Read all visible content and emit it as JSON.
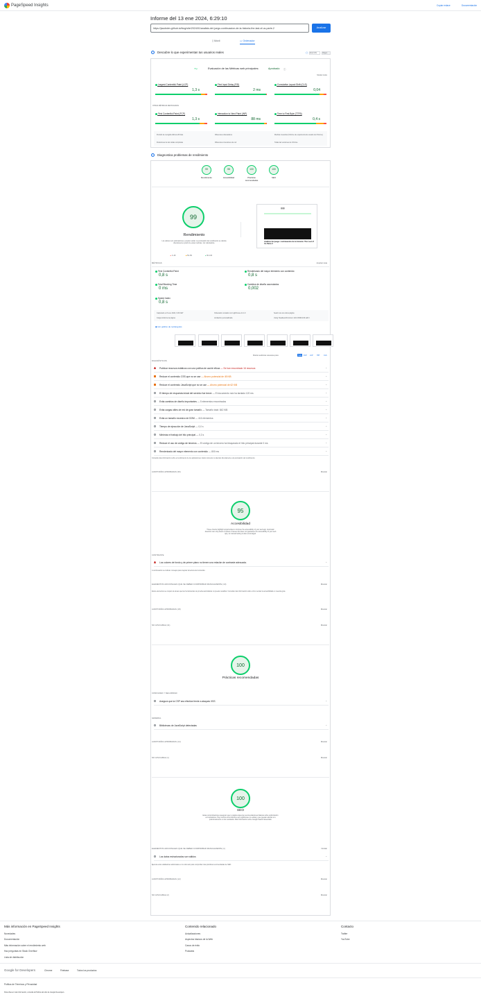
{
  "app": {
    "title": "PageSpeed Insights",
    "copy_link": "Copiar enlace",
    "docs": "Documentación"
  },
  "report": {
    "title": "Informe del 13 ene 2024, 6:29:10",
    "url": "https://jacobdev.github.io/blog/site/2024/01/analisis-del-juego-continuacion-de-la-historia-the-last-of-us-parte-2",
    "analyze": "Analizar"
  },
  "tabs": [
    {
      "label": "Móvil"
    },
    {
      "label": "Ordenador"
    }
  ],
  "field": {
    "title": "Descubre lo que experimentan tus usuarios reales",
    "toggle": "Esta URL",
    "origin": "Origen",
    "cwv_label": "Evaluación de las Métricas web principales:",
    "cwv_status": "Aprobado",
    "expand": "Mostrar todos",
    "metrics": [
      {
        "name": "Largest Contentful Paint (LCP)",
        "value": "1,3 s"
      },
      {
        "name": "First Input Delay (FID)",
        "value": "2 ms"
      },
      {
        "name": "Cumulative Layout Shift (CLS)",
        "value": "0,04"
      }
    ],
    "other_label": "OTRAS MÉTRICAS DESTACADAS",
    "other": [
      {
        "name": "First Contentful Paint (FCP)",
        "value": "1,3 s"
      },
      {
        "name": "Interaction to Next Paint (INP)",
        "value": "88 ms"
      },
      {
        "name": "Time to First Byte (TTFB)",
        "value": "0,4 s"
      }
    ],
    "info": [
      "Periodo de recogida últimos 28 días",
      "Diferentes ordenadores",
      "Muchas muestras (Informe de experiencia de usuario de Chrome)",
      "Duraciones de las visitas completas",
      "Diferentes conexiones de red",
      "Todas las versiones de Chrome"
    ]
  },
  "diag": {
    "title": "Diagnostica problemas de rendimiento",
    "scores": [
      {
        "value": "99",
        "label": "Rendimiento"
      },
      {
        "value": "95",
        "label": "Accesibilidad"
      },
      {
        "value": "100",
        "label": "Prácticas recomendadas"
      },
      {
        "value": "100",
        "label": "SEO"
      }
    ]
  },
  "perf": {
    "score": "99",
    "label": "Rendimiento",
    "note": "Los valores son estimaciones y pueden variar. La puntuación del rendimiento se calcula directamente a partir de estas métricas. Ver calculadora.",
    "legend": [
      "0–49",
      "50–89",
      "90–100"
    ],
    "shot_title": "Análisis del juego: continuación de la historia: The Last of Us Parte 2",
    "metrics_label": "MÉTRICAS",
    "expand": "Ampliar vista",
    "metrics": [
      {
        "name": "First Contentful Paint",
        "value": "0,8 s"
      },
      {
        "name": "Renderizado del mayor elemento con contenido",
        "value": "0,8 s"
      },
      {
        "name": "Total Blocking Time",
        "value": "0 ms"
      },
      {
        "name": "Cambios de diseño acumulados",
        "value": "0,002"
      },
      {
        "name": "Speed Index",
        "value": "0,8 s"
      }
    ],
    "info": [
      "Capturado a 13 ene 2024, 6:29 CET",
      "Carga inicial de la página",
      "Ordenador emulado con Lighthouse 11.4.0",
      "Limitación personalizada",
      "Sesión de una única página",
      "Using HeadlessChromium 120.0.6099.109 with lr"
    ],
    "treemap": "Ver gráfico de rectángulos",
    "filter_label": "Mostrar auditorías relevantes para:",
    "filters": [
      "Todo",
      "FCP",
      "LCP",
      "TBT",
      "CLS"
    ],
    "diag_label": "DIAGNÓSTICOS",
    "audits": [
      {
        "text": "Publicar recursos estáticos con una política de caché eficaz",
        "extra": "— Se han encontrado 16 recursos",
        "kind": "tri"
      },
      {
        "text": "Reduce el contenido CSS que no se use",
        "extra": "— Ahorro potencial de 45 KiB",
        "kind": "sq"
      },
      {
        "text": "Reduce el contenido JavaScript que no se use",
        "extra": "— Ahorro potencial de 62 KiB",
        "kind": "sq"
      },
      {
        "text": "El tiempo de respuesta inicial del servidor fue breve",
        "extra": "— El documento raíz ha tardado 120 ms",
        "kind": "c"
      },
      {
        "text": "Evita cambios de diseño importantes",
        "extra": "— 5 elementos encontrados",
        "kind": "c"
      },
      {
        "text": "Evita cargas útiles de red de gran tamaño",
        "extra": "— Tamaño total: 842 KiB",
        "kind": "c"
      },
      {
        "text": "Evita un tamaño excesivo de DOM",
        "extra": "— 416 elementos",
        "kind": "c"
      },
      {
        "text": "Tiempo de ejecución de JavaScript",
        "extra": "— 0,0 s",
        "kind": "c"
      },
      {
        "text": "Minimiza el trabajo del hilo principal",
        "extra": "— 0,3 s",
        "kind": "c"
      },
      {
        "text": "Reduce el uso de código de terceros",
        "extra": "— El código de un tercero ha bloqueado el hilo principal durante 0 ms",
        "kind": "c"
      },
      {
        "text": "Renderizado del mayor elemento con contenido",
        "extra": "— 800 ms",
        "kind": "c"
      }
    ],
    "diag_note": "Consulta más información sobre el rendimiento de tus aplicaciones. Estos números no afectan directamente a la puntuación del rendimiento.",
    "passed": "AUDITORÍAS APROBADAS (36)",
    "show": "Mostrar"
  },
  "a11y": {
    "score": "95",
    "label": "Accesibilidad",
    "note": "These checks highlight opportunities to improve the accessibility of your web app. Automatic detection can only detect a subset of issues and does not guarantee the accessibility of your web app, so manual testing is also encouraged.",
    "contrast_label": "CONTRASTE",
    "audit": "Los colores de fondo y de primer plano no tienen una relación de contraste adecuada.",
    "audit_note": "A continuación se indican consejos para mejorar la lectura del contenido.",
    "manual": "ELEMENTOS ADICIONALES QUE SE DEBEN COMPROBAR MANUALMENTE (10)",
    "manual_note": "Estos elementos se ocupan de áreas que las herramientas de prueba automáticas no pueden analizar. Consulta más información sobre cómo revisar la accesibilidad en nuestra guía.",
    "passed": "AUDITORÍAS APROBADAS (18)",
    "na": "NO APLICABLE (41)",
    "show": "Mostrar"
  },
  "bp": {
    "score": "100",
    "label": "Prácticas recomendadas",
    "sec": "CONFIANZA Y SEGURIDAD",
    "audit1": "Asegura que la CSP sea efectiva frente a ataques XSS",
    "general": "GENERAL",
    "audit2": "Bibliotecas de JavaScript detectadas",
    "passed": "AUDITORÍAS APROBADAS (14)",
    "na": "NO APLICABLE (1)",
    "show": "Mostrar"
  },
  "seo": {
    "score": "100",
    "label": "SEO",
    "note": "Estas comprobaciones aseguran que tu página sigue las recomendaciones básicas sobre optimización en buscadores. Hay muchos otros factores que Lighthouse no evalúa y que pueden afectar a tu posicionamiento en los resultados. Más información sobre Google Search Essentials.",
    "manual": "ELEMENTOS ADICIONALES QUE SE DEBEN COMPROBAR MANUALMENTE (1)",
    "hide": "Ocultar",
    "audit": "Los datos estructurados son válidos",
    "audit_note": "Ejecuta estos validadores adicionales en tu sitio web para comprobar más prácticas recomendadas de SEO.",
    "passed": "AUDITORÍAS APROBADAS (12)",
    "na": "NO APLICABLE (2)",
    "show": "Mostrar"
  },
  "footer": {
    "col1": {
      "title": "Más información en PageSpeed Insights",
      "links": [
        "Novedades",
        "Documentación",
        "Más información sobre el rendimiento web",
        "Haz preguntas en Stack Overflow",
        "Lista de distribución"
      ]
    },
    "col2": {
      "title": "Contenido relacionado",
      "links": [
        "Actualizaciones",
        "Aspectos básicos de la Web",
        "Casos de éxito",
        "Podcasts"
      ]
    },
    "col3": {
      "title": "Contacto",
      "links": [
        "Twitter",
        "YouTube"
      ]
    },
    "google_dev": "Google for Developers",
    "nav": [
      "Chrome",
      "Firebase",
      "Todos los productos"
    ],
    "policy": "Política de Términos y Privacidad",
    "more": "Para obtener más información, consulta la Política del sitio de Google Developers."
  },
  "colors": {
    "accent": "#1a73e8",
    "good": "#0cce6b",
    "avg": "#ffa400",
    "poor": "#ff4e42"
  }
}
